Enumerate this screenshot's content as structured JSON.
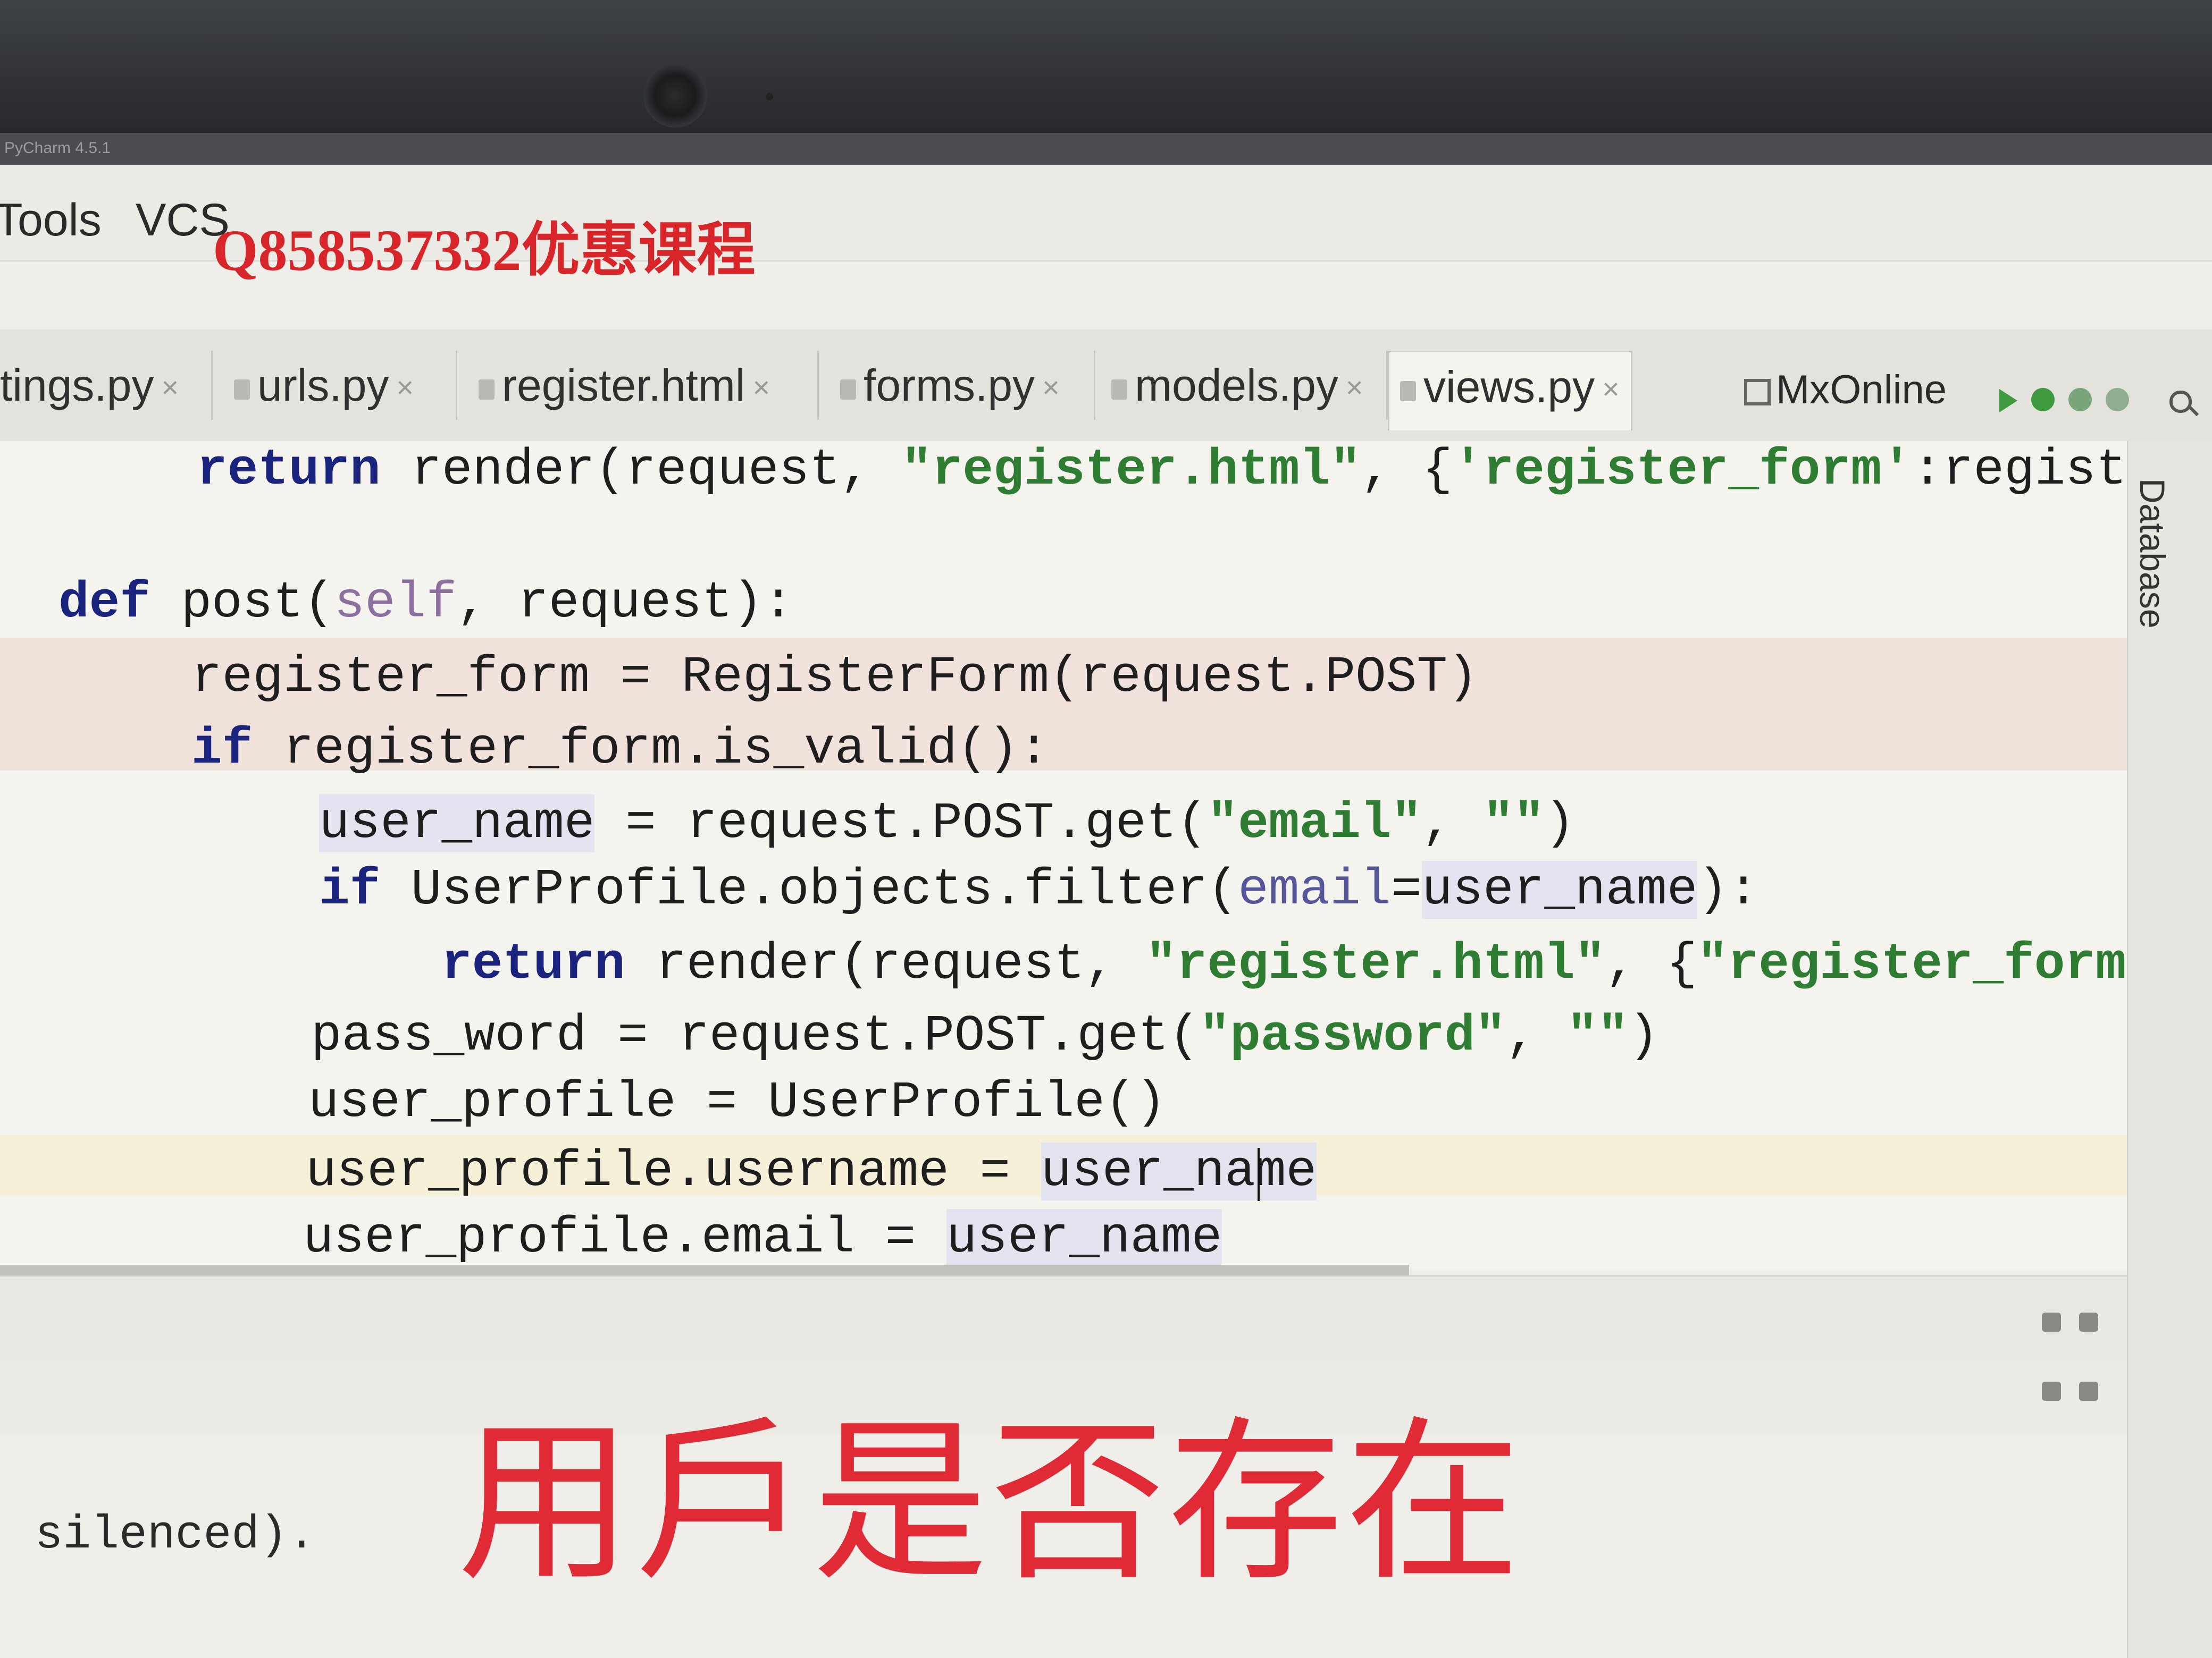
{
  "window": {
    "title_version": "PyCharm 4.5.1"
  },
  "menu": {
    "items": [
      "Tools",
      "VCS"
    ]
  },
  "watermark": "Q858537332优惠课程",
  "tabs": [
    {
      "label": "tings.py",
      "active": false
    },
    {
      "label": "urls.py",
      "active": false
    },
    {
      "label": "register.html",
      "active": false
    },
    {
      "label": "forms.py",
      "active": false
    },
    {
      "label": "models.py",
      "active": false
    },
    {
      "label": "views.py",
      "active": true
    }
  ],
  "toolbar": {
    "run_config": "MxOnline"
  },
  "side_panel": {
    "label": "Database"
  },
  "code": {
    "lines": [
      "return render(request, \"register.html\", {'register_form':register_",
      "def post(self, request):",
      "register_form = RegisterForm(request.POST)",
      "if register_form.is_valid():",
      "user_name = request.POST.get(\"email\", \"\")",
      "if UserProfile.objects.filter(email=user_name):",
      "return render(request, \"register.html\", {\"register_form\":r",
      "pass_word = request.POST.get(\"password\", \"\")",
      "user_profile = UserProfile()",
      "user_profile.username = user_name",
      "user_profile.email = user_name"
    ]
  },
  "console": {
    "line": ") silenced)."
  },
  "caption": "用戶是否存在",
  "colors": {
    "keyword": "#1a237e",
    "string": "#2e7d32",
    "caption": "#e02b36",
    "watermark": "#d8252a"
  }
}
